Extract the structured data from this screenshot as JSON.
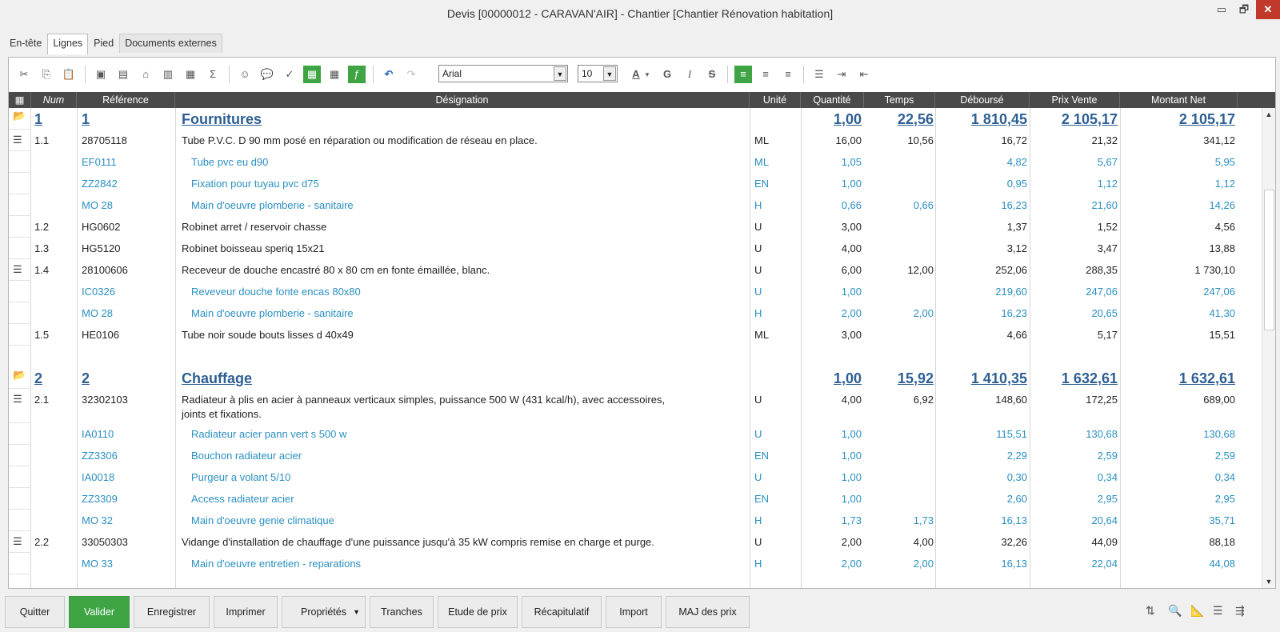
{
  "window": {
    "title": "Devis [00000012 - CARAVAN'AIR] - Chantier [Chantier Rénovation habitation]",
    "min": "▭",
    "max": "🗗",
    "close": "✕"
  },
  "tabs": [
    {
      "label": "En-tête"
    },
    {
      "label": "Lignes"
    },
    {
      "label": "Pied"
    },
    {
      "label": "Documents externes"
    }
  ],
  "toolbar": {
    "font": "Arial",
    "size": "10",
    "bold": "G",
    "italic": "I",
    "strike": "S",
    "icons": [
      "cut-icon",
      "copy-icon",
      "paste-icon",
      "insert-icon",
      "insert-2-icon",
      "insert-3-icon",
      "insert-4-icon",
      "insert-5-icon",
      "sum-icon",
      "person-icon",
      "comment-icon",
      "spell-icon",
      "table-green-icon",
      "table-icon",
      "formula-green-icon",
      "undo-icon",
      "redo-icon"
    ]
  },
  "columns": [
    "Num",
    "Référence",
    "Désignation",
    "Unité",
    "Quantité",
    "Temps",
    "Déboursé",
    "Prix Vente",
    "Montant Net"
  ],
  "rows": [
    {
      "kind": "lv1",
      "icon": "folder",
      "num": "1",
      "ref": "1",
      "desig": "Fournitures",
      "unit": "",
      "qty": "1,00",
      "time": "22,56",
      "deb": "1 810,45",
      "pv": "2 105,17",
      "mt": "2 105,17"
    },
    {
      "kind": "main",
      "icon": "list",
      "num": "1.1",
      "ref": "28705118",
      "desig": "Tube P.V.C. D 90 mm posé en réparation ou modification de réseau en place.",
      "unit": "ML",
      "qty": "16,00",
      "time": "10,56",
      "deb": "16,72",
      "pv": "21,32",
      "mt": "341,12"
    },
    {
      "kind": "sub",
      "num": "",
      "ref": "EF0111",
      "desig": "Tube pvc eu d90",
      "unit": "ML",
      "qty": "1,05",
      "time": "",
      "deb": "4,82",
      "pv": "5,67",
      "mt": "5,95"
    },
    {
      "kind": "sub",
      "num": "",
      "ref": "ZZ2842",
      "desig": "Fixation pour tuyau pvc d75",
      "unit": "EN",
      "qty": "1,00",
      "time": "",
      "deb": "0,95",
      "pv": "1,12",
      "mt": "1,12"
    },
    {
      "kind": "sub",
      "num": "",
      "ref": "MO 28",
      "desig": "Main d'oeuvre plomberie - sanitaire",
      "unit": "H",
      "qty": "0,66",
      "time": "0,66",
      "deb": "16,23",
      "pv": "21,60",
      "mt": "14,26"
    },
    {
      "kind": "main",
      "num": "1.2",
      "ref": "HG0602",
      "desig": "Robinet arret / reservoir chasse",
      "unit": "U",
      "qty": "3,00",
      "time": "",
      "deb": "1,37",
      "pv": "1,52",
      "mt": "4,56"
    },
    {
      "kind": "main",
      "num": "1.3",
      "ref": "HG5120",
      "desig": "Robinet boisseau speriq 15x21",
      "unit": "U",
      "qty": "4,00",
      "time": "",
      "deb": "3,12",
      "pv": "3,47",
      "mt": "13,88"
    },
    {
      "kind": "main",
      "icon": "list",
      "num": "1.4",
      "ref": "28100606",
      "desig": "Receveur de douche encastré 80 x 80 cm en fonte émaillée, blanc.",
      "unit": "U",
      "qty": "6,00",
      "time": "12,00",
      "deb": "252,06",
      "pv": "288,35",
      "mt": "1 730,10"
    },
    {
      "kind": "sub",
      "num": "",
      "ref": "IC0326",
      "desig": "Reveveur douche fonte encas 80x80",
      "unit": "U",
      "qty": "1,00",
      "time": "",
      "deb": "219,60",
      "pv": "247,06",
      "mt": "247,06"
    },
    {
      "kind": "sub",
      "num": "",
      "ref": "MO 28",
      "desig": "Main d'oeuvre plomberie - sanitaire",
      "unit": "H",
      "qty": "2,00",
      "time": "2,00",
      "deb": "16,23",
      "pv": "20,65",
      "mt": "41,30"
    },
    {
      "kind": "main",
      "num": "1.5",
      "ref": "HE0106",
      "desig": "Tube noir soude bouts lisses d 40x49",
      "unit": "ML",
      "qty": "3,00",
      "time": "",
      "deb": "4,66",
      "pv": "5,17",
      "mt": "15,51"
    },
    {
      "kind": "lv1",
      "icon": "folder",
      "num": "2",
      "ref": "2",
      "desig": "Chauffage",
      "unit": "",
      "qty": "1,00",
      "time": "15,92",
      "deb": "1 410,35",
      "pv": "1 632,61",
      "mt": "1 632,61"
    },
    {
      "kind": "main",
      "icon": "list",
      "num": "2.1",
      "ref": "32302103",
      "desig": "Radiateur à plis en acier à panneaux verticaux simples, puissance 500 W (431 kcal/h), avec accessoires,",
      "desig2": "joints et fixations.",
      "unit": "U",
      "qty": "4,00",
      "time": "6,92",
      "deb": "148,60",
      "pv": "172,25",
      "mt": "689,00"
    },
    {
      "kind": "sub",
      "num": "",
      "ref": "IA0110",
      "desig": "Radiateur acier pann vert s 500 w",
      "unit": "U",
      "qty": "1,00",
      "time": "",
      "deb": "115,51",
      "pv": "130,68",
      "mt": "130,68"
    },
    {
      "kind": "sub",
      "num": "",
      "ref": "ZZ3306",
      "desig": "Bouchon radiateur acier",
      "unit": "EN",
      "qty": "1,00",
      "time": "",
      "deb": "2,29",
      "pv": "2,59",
      "mt": "2,59"
    },
    {
      "kind": "sub",
      "num": "",
      "ref": "IA0018",
      "desig": "Purgeur a volant 5/10",
      "unit": "U",
      "qty": "1,00",
      "time": "",
      "deb": "0,30",
      "pv": "0,34",
      "mt": "0,34"
    },
    {
      "kind": "sub",
      "num": "",
      "ref": "ZZ3309",
      "desig": "Access radiateur acier",
      "unit": "EN",
      "qty": "1,00",
      "time": "",
      "deb": "2,60",
      "pv": "2,95",
      "mt": "2,95"
    },
    {
      "kind": "sub",
      "num": "",
      "ref": "MO 32",
      "desig": "Main d'oeuvre genie climatique",
      "unit": "H",
      "qty": "1,73",
      "time": "1,73",
      "deb": "16,13",
      "pv": "20,64",
      "mt": "35,71"
    },
    {
      "kind": "main",
      "icon": "list",
      "num": "2.2",
      "ref": "33050303",
      "desig": "Vidange d'installation de chauffage d'une puissance jusqu'à 35 kW compris remise en charge et purge.",
      "unit": "U",
      "qty": "2,00",
      "time": "4,00",
      "deb": "32,26",
      "pv": "44,09",
      "mt": "88,18"
    },
    {
      "kind": "sub",
      "num": "",
      "ref": "MO 33",
      "desig": "Main d'oeuvre entretien - reparations",
      "unit": "H",
      "qty": "2,00",
      "time": "2,00",
      "deb": "16,13",
      "pv": "22,04",
      "mt": "44,08"
    }
  ],
  "buttons": [
    "Quitter",
    "Valider",
    "Enregistrer",
    "Imprimer",
    "Propriétés",
    "Tranches",
    "Etude de prix",
    "Récapitulatif",
    "Import",
    "MAJ des prix"
  ]
}
